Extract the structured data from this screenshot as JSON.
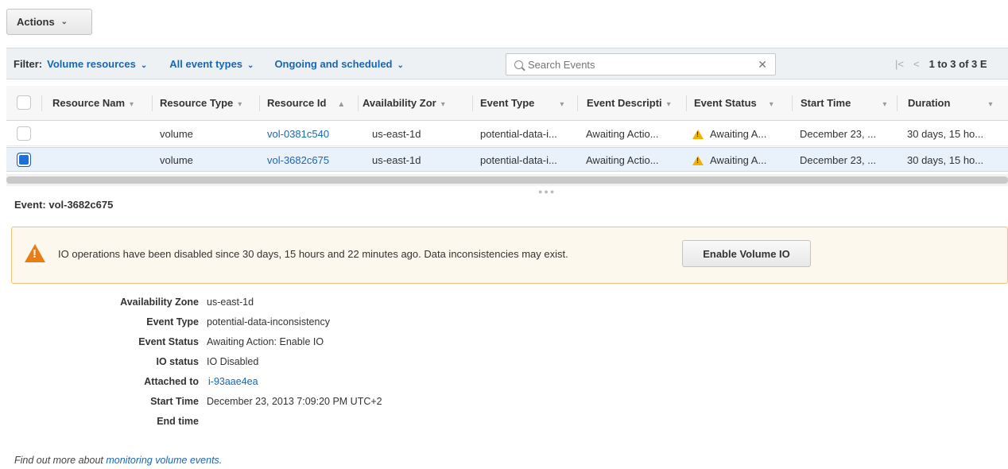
{
  "toolbar": {
    "actions_label": "Actions"
  },
  "filter": {
    "label": "Filter:",
    "resources": "Volume resources",
    "event_types": "All event types",
    "schedule": "Ongoing and scheduled",
    "search_placeholder": "Search Events",
    "pager_text": "1 to 3 of 3 E"
  },
  "table": {
    "columns": [
      "Resource Nam",
      "Resource Type",
      "Resource Id",
      "Availability Zor",
      "Event Type",
      "Event Descripti",
      "Event Status",
      "Start Time",
      "Duration"
    ],
    "rows": [
      {
        "resource_name": "",
        "resource_type": "volume",
        "resource_id": "vol-0381c540",
        "availability_zone": "us-east-1d",
        "event_type": "potential-data-i...",
        "event_description": "Awaiting Actio...",
        "event_status": "Awaiting A...",
        "start_time": "December 23, ...",
        "duration": "30 days, 15 ho...",
        "selected": false
      },
      {
        "resource_name": "",
        "resource_type": "volume",
        "resource_id": "vol-3682c675",
        "availability_zone": "us-east-1d",
        "event_type": "potential-data-i...",
        "event_description": "Awaiting Actio...",
        "event_status": "Awaiting A...",
        "start_time": "December 23, ...",
        "duration": "30 days, 15 ho...",
        "selected": true
      }
    ]
  },
  "event": {
    "title": "Event: vol-3682c675",
    "alert_text": "IO operations have been disabled since 30 days, 15 hours and 22 minutes ago. Data inconsistencies may exist.",
    "enable_button": "Enable Volume IO",
    "details": [
      {
        "label": "Availability Zone",
        "value": "us-east-1d"
      },
      {
        "label": "Event Type",
        "value": "potential-data-inconsistency"
      },
      {
        "label": "Event Status",
        "value": "Awaiting Action: Enable IO"
      },
      {
        "label": "IO status",
        "value": "IO Disabled"
      },
      {
        "label": "Attached to",
        "value": "i-93aae4ea"
      },
      {
        "label": "Start Time",
        "value": "December 23, 2013 7:09:20 PM UTC+2"
      },
      {
        "label": "End time",
        "value": ""
      }
    ]
  },
  "footer": {
    "prefix": "Find out more about",
    "link": "monitoring volume events",
    "suffix": "."
  },
  "colors": {
    "link": "#1a66b3",
    "warning": "#e87d13",
    "selected_row": "#e9f1fb",
    "checkbox_checked": "#1f6fdb"
  }
}
